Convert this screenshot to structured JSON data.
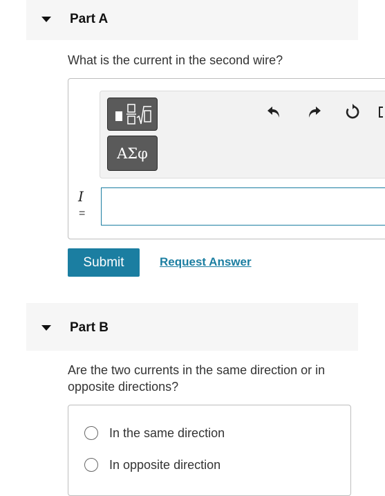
{
  "part_a": {
    "title": "Part A",
    "question": "What is the current in the second wire?",
    "toolbar": {
      "template_icon": "fraction-root-template-icon",
      "greek_label": "ΑΣφ",
      "undo_icon": "undo-icon",
      "redo_icon": "redo-icon",
      "reset_icon": "reset-icon"
    },
    "variable": "I",
    "equals": "=",
    "answer_value": "",
    "submit_label": "Submit",
    "request_label": "Request Answer"
  },
  "part_b": {
    "title": "Part B",
    "question": "Are the two currents in the same direction or in opposite directions?",
    "options": [
      "In the same direction",
      "In opposite direction"
    ]
  },
  "colors": {
    "accent": "#1b7ea1",
    "header_bg": "#f6f6f6",
    "toolbar_btn": "#5a5a5a"
  }
}
